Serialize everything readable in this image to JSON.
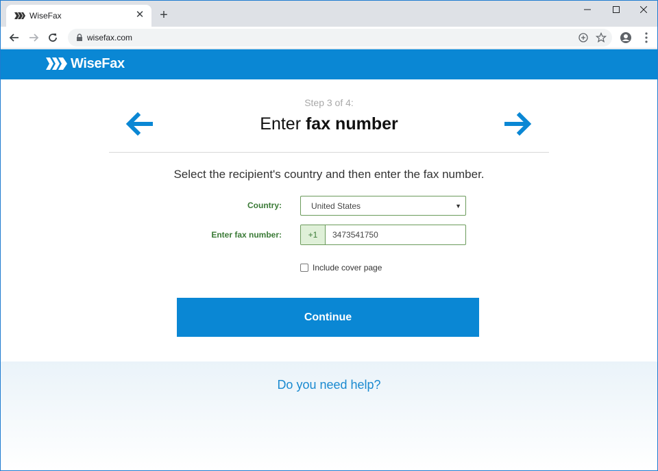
{
  "browser": {
    "tab_title": "WiseFax",
    "tab_close_icon": "close-icon",
    "new_tab_label": "+",
    "url": "wisefax.com",
    "window_controls": [
      "minimize-icon",
      "maximize-icon",
      "close-icon"
    ]
  },
  "site": {
    "brand": "WiseFax",
    "brand_color": "#0a87d4"
  },
  "wizard": {
    "step": "Step 3 of 4:",
    "title_prefix": "Enter ",
    "title_bold": "fax number",
    "instructions": "Select the recipient's country and then enter the fax number.",
    "country_label": "Country:",
    "country_value": "United States",
    "fax_label": "Enter fax number:",
    "country_code": "+1",
    "fax_value": "3473541750",
    "cover_page_label": "Include cover page",
    "cover_page_checked": false,
    "continue_label": "Continue"
  },
  "help": {
    "link_text": "Do you need help?"
  },
  "colors": {
    "accent": "#0a87d4",
    "label_green": "#3a7a36"
  }
}
